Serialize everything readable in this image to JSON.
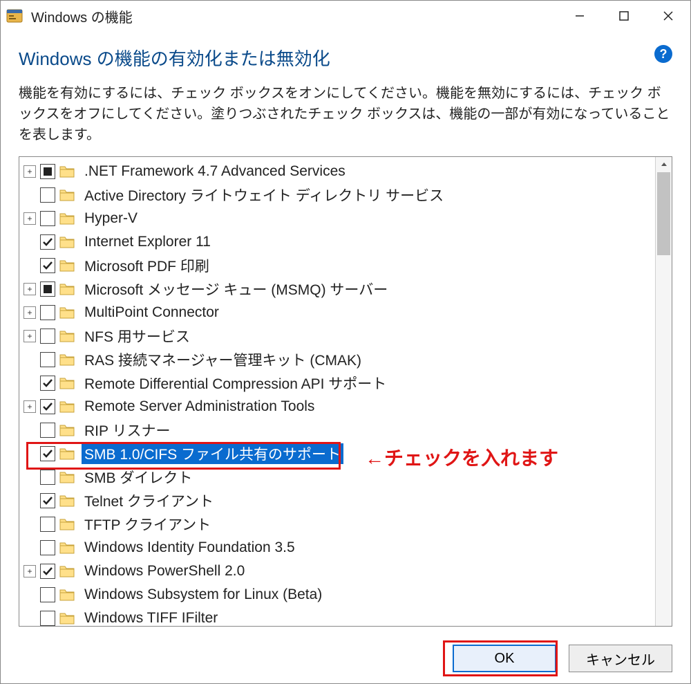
{
  "titlebar": {
    "title": "Windows の機能"
  },
  "heading": "Windows の機能の有効化または無効化",
  "description": "機能を有効にするには、チェック ボックスをオンにしてください。機能を無効にするには、チェック ボックスをオフにしてください。塗りつぶされたチェック ボックスは、機能の一部が有効になっていることを表します。",
  "features": [
    {
      "expander": "+",
      "state": "partial",
      "label": ".NET Framework 4.7 Advanced Services",
      "selected": false
    },
    {
      "expander": "",
      "state": "off",
      "label": "Active Directory ライトウェイト ディレクトリ サービス",
      "selected": false
    },
    {
      "expander": "+",
      "state": "off",
      "label": "Hyper-V",
      "selected": false
    },
    {
      "expander": "",
      "state": "on",
      "label": "Internet Explorer 11",
      "selected": false
    },
    {
      "expander": "",
      "state": "on",
      "label": "Microsoft PDF 印刷",
      "selected": false
    },
    {
      "expander": "+",
      "state": "partial",
      "label": "Microsoft メッセージ キュー (MSMQ) サーバー",
      "selected": false
    },
    {
      "expander": "+",
      "state": "off",
      "label": "MultiPoint Connector",
      "selected": false
    },
    {
      "expander": "+",
      "state": "off",
      "label": "NFS 用サービス",
      "selected": false
    },
    {
      "expander": "",
      "state": "off",
      "label": "RAS 接続マネージャー管理キット (CMAK)",
      "selected": false
    },
    {
      "expander": "",
      "state": "on",
      "label": "Remote Differential Compression API サポート",
      "selected": false
    },
    {
      "expander": "+",
      "state": "on",
      "label": "Remote Server Administration Tools",
      "selected": false
    },
    {
      "expander": "",
      "state": "off",
      "label": "RIP リスナー",
      "selected": false
    },
    {
      "expander": "",
      "state": "on",
      "label": "SMB 1.0/CIFS ファイル共有のサポート",
      "selected": true
    },
    {
      "expander": "",
      "state": "off",
      "label": "SMB ダイレクト",
      "selected": false
    },
    {
      "expander": "",
      "state": "on",
      "label": "Telnet クライアント",
      "selected": false
    },
    {
      "expander": "",
      "state": "off",
      "label": "TFTP クライアント",
      "selected": false
    },
    {
      "expander": "",
      "state": "off",
      "label": "Windows Identity Foundation 3.5",
      "selected": false
    },
    {
      "expander": "+",
      "state": "on",
      "label": "Windows PowerShell 2.0",
      "selected": false
    },
    {
      "expander": "",
      "state": "off",
      "label": "Windows Subsystem for Linux (Beta)",
      "selected": false
    },
    {
      "expander": "",
      "state": "off",
      "label": "Windows TIFF IFilter",
      "selected": false
    }
  ],
  "annotation": {
    "text": "←チェックを入れます"
  },
  "buttons": {
    "ok": "OK",
    "cancel": "キャンセル"
  }
}
